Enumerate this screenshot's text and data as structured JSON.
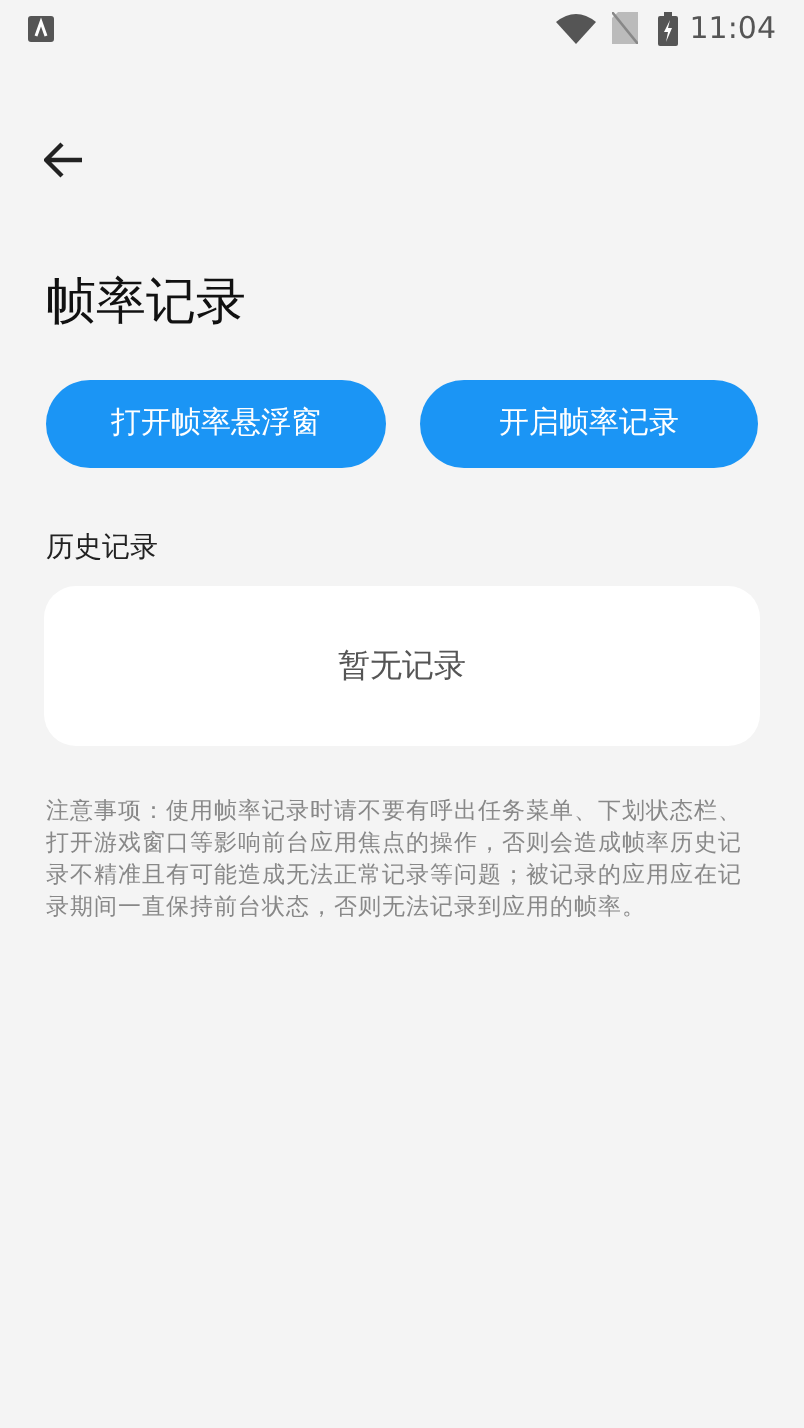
{
  "status_bar": {
    "time": "11:04"
  },
  "title": "帧率记录",
  "buttons": [
    "打开帧率悬浮窗",
    "开启帧率记录"
  ],
  "history": {
    "heading": "历史记录",
    "empty_text": "暂无记录"
  },
  "note": "注意事项：使用帧率记录时请不要有呼出任务菜单、下划状态栏、打开游戏窗口等影响前台应用焦点的操作，否则会造成帧率历史记录不精准且有可能造成无法正常记录等问题；被记录的应用应在记录期间一直保持前台状态，否则无法记录到应用的帧率。"
}
